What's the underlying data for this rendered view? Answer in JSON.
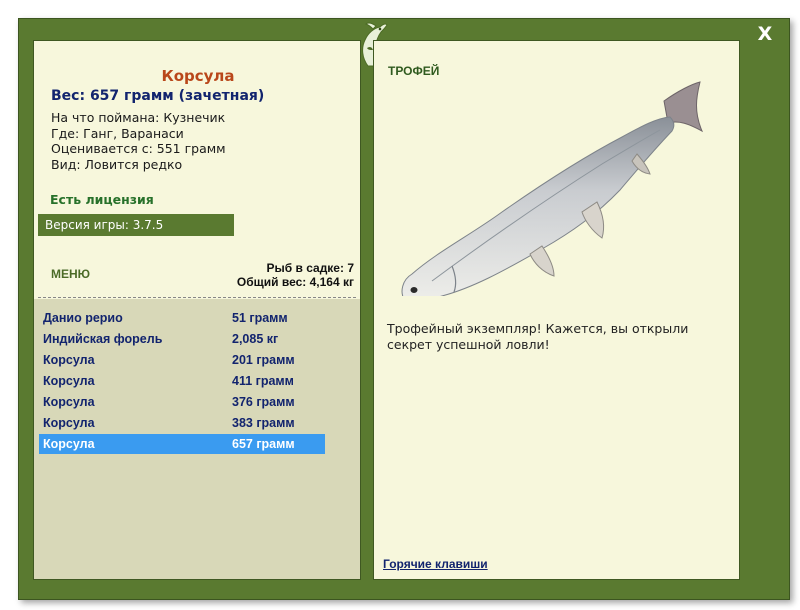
{
  "close_label": "X",
  "fish": {
    "name": "Корсула",
    "weight_line": "Вес: 657 грамм (зачетная)",
    "bait": "На что поймана: Кузнечик",
    "location": "Где: Ганг, Варанаси",
    "rating": "Оценивается с: 551 грамм",
    "kind": "Вид: Ловится редко"
  },
  "license": "Есть лицензия",
  "version": "Версия игры: 3.7.5",
  "menu_label": "МЕНЮ",
  "stats": {
    "in_keepnet": "Рыб в садке: 7",
    "total_weight": "Общий вес: 4,164 кг"
  },
  "catch_list": [
    {
      "name": "Данио рерио",
      "weight": "51 грамм"
    },
    {
      "name": "Индийская форель",
      "weight": "2,085 кг"
    },
    {
      "name": "Корсула",
      "weight": "201 грамм"
    },
    {
      "name": "Корсула",
      "weight": "411 грамм"
    },
    {
      "name": "Корсула",
      "weight": "376 грамм"
    },
    {
      "name": "Корсула",
      "weight": "383 грамм"
    },
    {
      "name": "Корсула",
      "weight": "657 грамм"
    }
  ],
  "trophy_label": "ТРОФЕЙ",
  "trophy_description": "Трофейный экземпляр! Кажется, вы открыли секрет успешной ловли!",
  "hotkeys_label": "Горячие клавиши",
  "colors": {
    "frame": "#5a7a30",
    "panel": "#f7f7dc",
    "list_bg": "#d8d8b8",
    "selected_row": "#3a9bf0",
    "title": "#b9471a",
    "navy": "#12246e"
  },
  "logo_icon": "fish-chameleon-logo-icon"
}
